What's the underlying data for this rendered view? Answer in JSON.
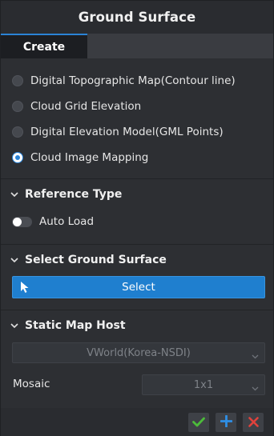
{
  "window": {
    "title": "Ground Surface"
  },
  "tabs": [
    {
      "label": "Create",
      "active": true
    }
  ],
  "source_options": [
    {
      "label": "Digital Topographic Map(Contour line)",
      "selected": false
    },
    {
      "label": "Cloud Grid Elevation",
      "selected": false
    },
    {
      "label": "Digital Elevation Model(GML Points)",
      "selected": false
    },
    {
      "label": "Cloud Image Mapping",
      "selected": true
    }
  ],
  "reference_type": {
    "title": "Reference Type",
    "auto_load": {
      "label": "Auto Load",
      "on": false
    }
  },
  "select_ground": {
    "title": "Select Ground Surface",
    "button_label": "Select"
  },
  "static_map_host": {
    "title": "Static Map Host",
    "host_value": "VWorld(Korea-NSDI)",
    "mosaic_label": "Mosaic",
    "mosaic_value": "1x1"
  },
  "footer": {
    "icons": [
      "check-icon",
      "plus-icon",
      "close-icon"
    ]
  },
  "colors": {
    "accent": "#2a83d6",
    "confirm": "#4cbb3a",
    "add": "#2e8fe6",
    "cancel": "#e0423c"
  }
}
